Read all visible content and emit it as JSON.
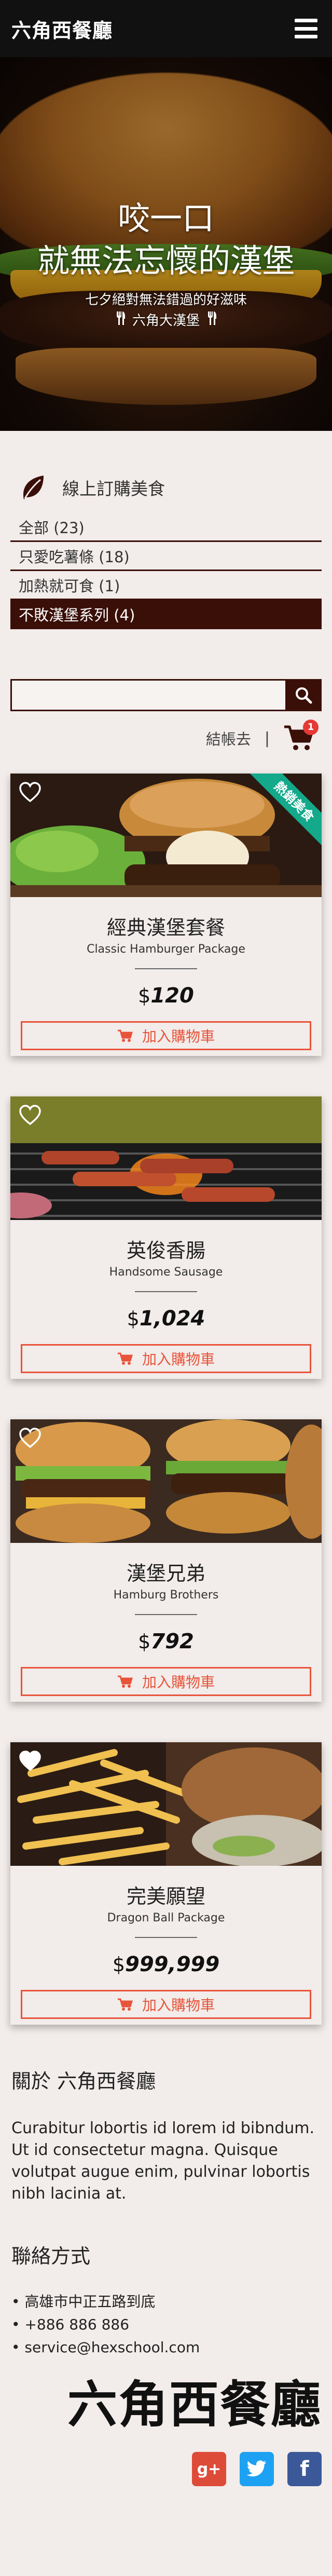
{
  "header": {
    "brand": "六角西餐廳",
    "menu_icon": "hamburger-menu-icon"
  },
  "hero": {
    "title_line1": "咬一口",
    "title_line2": "就無法忘懷的漢堡",
    "subtitle": "七夕絕對無法錯過的好滋味",
    "tagline": "六角大漢堡"
  },
  "categories": {
    "title": "線上訂購美食",
    "icon": "leaf-icon",
    "items": [
      {
        "label": "全部 (23)"
      },
      {
        "label": "只愛吃薯條 (18)"
      },
      {
        "label": "加熱就可食 (1)"
      },
      {
        "label": "不敗漢堡系列 (4)",
        "active": true
      }
    ]
  },
  "search": {
    "placeholder": "",
    "icon": "search-icon"
  },
  "cart": {
    "checkout_label": "結帳去",
    "separator": "|",
    "badge": "1",
    "icon": "shopping-cart-icon"
  },
  "products": [
    {
      "name": "經典漢堡套餐",
      "en": "Classic Hamburger Package",
      "currency": "$",
      "price": "120",
      "ribbon": "熱銷美食",
      "add_label": "加入購物車"
    },
    {
      "name": "英俊香腸",
      "en": "Handsome Sausage",
      "currency": "$",
      "price": "1,024",
      "ribbon": "",
      "add_label": "加入購物車"
    },
    {
      "name": "漢堡兄弟",
      "en": "Hamburg Brothers",
      "currency": "$",
      "price": "792",
      "ribbon": "",
      "add_label": "加入購物車"
    },
    {
      "name": "完美願望",
      "en": "Dragon Ball Package",
      "currency": "$",
      "price": "999,999",
      "ribbon": "",
      "add_label": "加入購物車"
    }
  ],
  "about": {
    "title": "關於 六角西餐廳",
    "body": "Curabitur lobortis id lorem id bibndum. Ut id consectetur magna. Quisque volutpat augue enim, pulvinar lobortis nibh lacinia at."
  },
  "contact": {
    "title": "聯絡方式",
    "items": [
      "• 高雄市中正五路到底",
      "• +886 886 886",
      "• service@hexschool.com"
    ]
  },
  "footer": {
    "brand": "六角西餐廳",
    "socials": [
      {
        "label": "g+",
        "icon": "google-plus-icon",
        "color": "#dd4b39"
      },
      {
        "label": "t",
        "icon": "twitter-icon",
        "color": "#1da1f2"
      },
      {
        "label": "f",
        "icon": "facebook-icon",
        "color": "#3b5998"
      }
    ]
  },
  "colors": {
    "accent_dark": "#3a0f08",
    "button_red": "#e8543a",
    "ribbon_green": "#13a98a",
    "background": "#f2ecea"
  }
}
